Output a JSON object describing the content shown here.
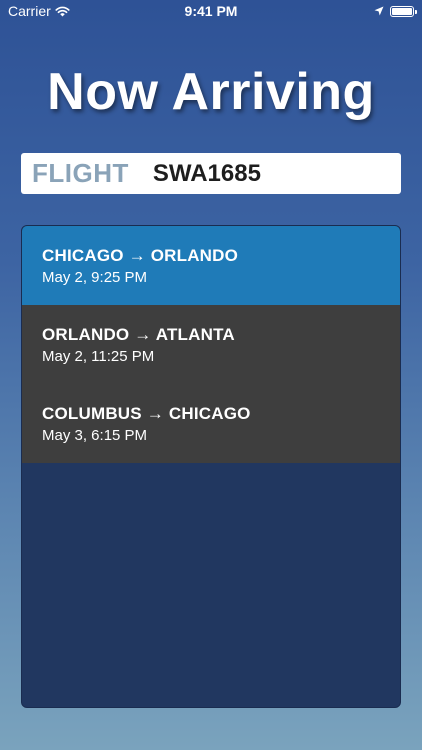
{
  "status_bar": {
    "carrier": "Carrier",
    "time": "9:41 PM",
    "wifi_icon": "wifi-icon",
    "location_icon": "location-arrow-icon",
    "battery_level": 1.0
  },
  "header": {
    "title": "Now Arriving"
  },
  "flight_search": {
    "label": "FLIGHT",
    "value": "SWA1685"
  },
  "legs": [
    {
      "route": "CHICAGO → ORLANDO",
      "time": "May 2, 9:25 PM",
      "selected": true
    },
    {
      "route": "ORLANDO → ATLANTA",
      "time": "May 2, 11:25 PM",
      "selected": false
    },
    {
      "route": "COLUMBUS → CHICAGO",
      "time": "May 3, 6:15 PM",
      "selected": false
    }
  ],
  "colors": {
    "selected_row": "#1f7bb8",
    "row": "#3e3e3e",
    "panel": "#213760",
    "label": "#8aa3b8"
  }
}
